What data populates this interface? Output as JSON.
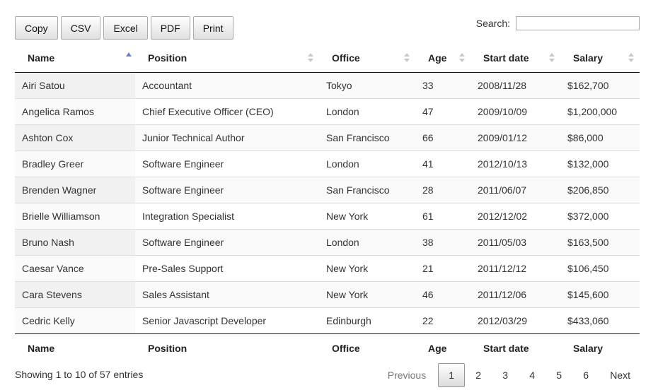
{
  "toolbar": {
    "buttons": [
      "Copy",
      "CSV",
      "Excel",
      "PDF",
      "Print"
    ]
  },
  "search": {
    "label": "Search:",
    "value": ""
  },
  "table": {
    "columns": [
      "Name",
      "Position",
      "Office",
      "Age",
      "Start date",
      "Salary"
    ],
    "sorted_column": "Name",
    "sort_direction": "asc",
    "rows": [
      [
        "Airi Satou",
        "Accountant",
        "Tokyo",
        "33",
        "2008/11/28",
        "$162,700"
      ],
      [
        "Angelica Ramos",
        "Chief Executive Officer (CEO)",
        "London",
        "47",
        "2009/10/09",
        "$1,200,000"
      ],
      [
        "Ashton Cox",
        "Junior Technical Author",
        "San Francisco",
        "66",
        "2009/01/12",
        "$86,000"
      ],
      [
        "Bradley Greer",
        "Software Engineer",
        "London",
        "41",
        "2012/10/13",
        "$132,000"
      ],
      [
        "Brenden Wagner",
        "Software Engineer",
        "San Francisco",
        "28",
        "2011/06/07",
        "$206,850"
      ],
      [
        "Brielle Williamson",
        "Integration Specialist",
        "New York",
        "61",
        "2012/12/02",
        "$372,000"
      ],
      [
        "Bruno Nash",
        "Software Engineer",
        "London",
        "38",
        "2011/05/03",
        "$163,500"
      ],
      [
        "Caesar Vance",
        "Pre-Sales Support",
        "New York",
        "21",
        "2011/12/12",
        "$106,450"
      ],
      [
        "Cara Stevens",
        "Sales Assistant",
        "New York",
        "46",
        "2011/12/06",
        "$145,600"
      ],
      [
        "Cedric Kelly",
        "Senior Javascript Developer",
        "Edinburgh",
        "22",
        "2012/03/29",
        "$433,060"
      ]
    ]
  },
  "info": "Showing 1 to 10 of 57 entries",
  "pagination": {
    "previous": "Previous",
    "pages": [
      "1",
      "2",
      "3",
      "4",
      "5",
      "6"
    ],
    "current": "1",
    "next": "Next"
  },
  "colors": {
    "sort_active": "#6b80c4",
    "sort_inactive": "#c8c8c8",
    "row_stripe": "#f9f9f9",
    "sorted_cell": "#f1f1f1"
  }
}
